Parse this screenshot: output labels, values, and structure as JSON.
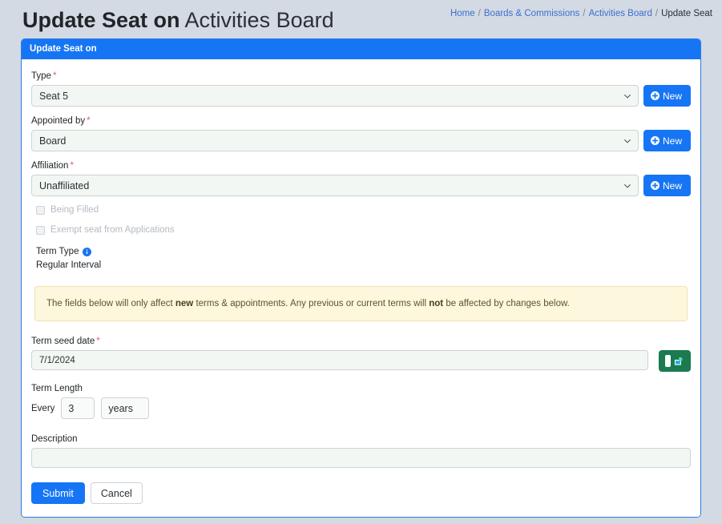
{
  "header": {
    "title_strong": "Update Seat on",
    "title_light": "Activities Board"
  },
  "breadcrumb": {
    "items": [
      {
        "label": "Home",
        "link": true
      },
      {
        "label": "Boards & Commissions",
        "link": true
      },
      {
        "label": "Activities Board",
        "link": true
      },
      {
        "label": "Update Seat",
        "link": false
      }
    ],
    "separator": "/"
  },
  "card": {
    "header_title": "Update Seat on"
  },
  "form": {
    "type": {
      "label": "Type",
      "required_marker": "*",
      "value": "Seat 5",
      "new_button": "New",
      "icon": "plus-circle-icon"
    },
    "appointed_by": {
      "label": "Appointed by",
      "required_marker": "*",
      "value": "Board",
      "new_button": "New",
      "icon": "plus-circle-icon"
    },
    "affiliation": {
      "label": "Affiliation",
      "required_marker": "*",
      "value": "Unaffiliated",
      "new_button": "New",
      "icon": "plus-circle-icon"
    },
    "being_filled": {
      "label": "Being Filled",
      "checked": false,
      "disabled": true
    },
    "exempt_seat": {
      "label": "Exempt seat from Applications",
      "checked": false,
      "disabled": true
    },
    "term_type": {
      "label": "Term Type",
      "info_icon": "info-circle-icon",
      "value": "Regular Interval"
    },
    "alert": {
      "text_part_1": "The fields below will only affect ",
      "bold_1": "new",
      "text_part_2": " terms & appointments. Any previous or current terms will ",
      "bold_2": "not",
      "text_part_3": " be affected by changes below."
    },
    "term_seed_date": {
      "label": "Term seed date",
      "required_marker": "*",
      "value": "7/1/2024",
      "calendar_button_icon": "calendar-icon"
    },
    "term_length": {
      "label": "Term Length",
      "every_label": "Every",
      "amount": "3",
      "unit": "years"
    },
    "description": {
      "label": "Description",
      "value": ""
    }
  },
  "footer": {
    "submit_label": "Submit",
    "cancel_label": "Cancel"
  },
  "colors": {
    "primary": "#1675f5",
    "card_border": "#2c7be5",
    "page_bg": "#d3dae3",
    "alert_bg": "#fdf7dd",
    "alert_border": "#f0e2b0",
    "calendar_btn": "#1b7a4f",
    "required": "#e45d5d",
    "link": "#3c6fd0"
  }
}
